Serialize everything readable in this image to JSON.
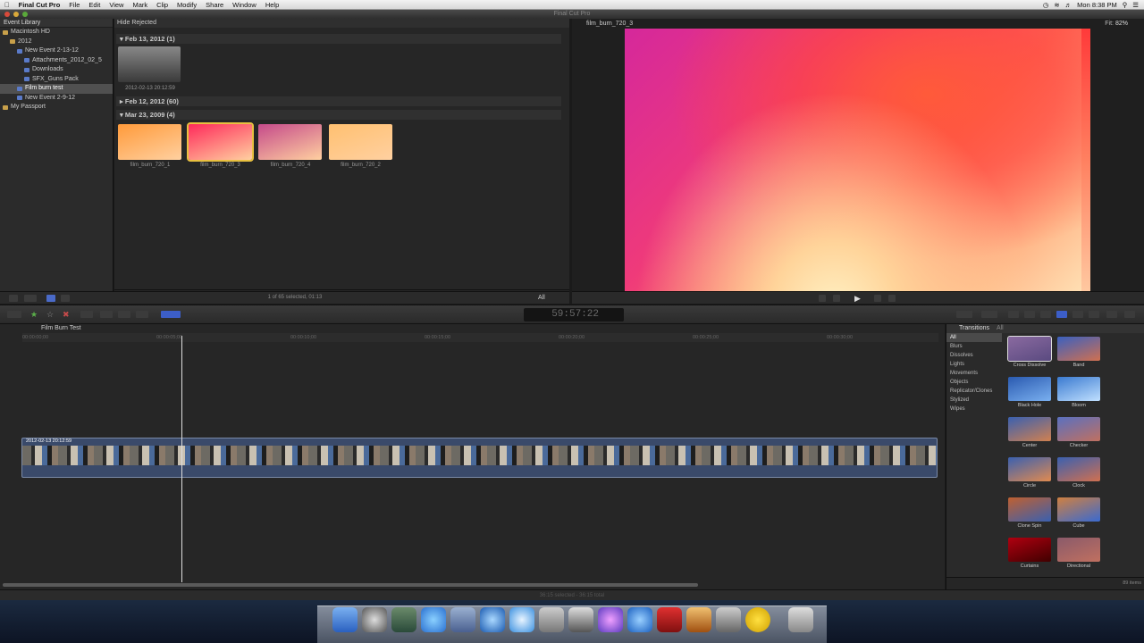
{
  "menubar": {
    "app": "Final Cut Pro",
    "items": [
      "File",
      "Edit",
      "View",
      "Mark",
      "Clip",
      "Modify",
      "Share",
      "Window",
      "Help"
    ],
    "clock": "Mon 8:38 PM"
  },
  "window": {
    "title": "Final Cut Pro"
  },
  "library": {
    "header": "Event Library",
    "items": [
      {
        "label": "Macintosh HD",
        "indent": 0
      },
      {
        "label": "2012",
        "indent": 1
      },
      {
        "label": "New Event 2-13-12",
        "indent": 2
      },
      {
        "label": "Attachments_2012_02_5",
        "indent": 3
      },
      {
        "label": "Downloads",
        "indent": 3
      },
      {
        "label": "SFX_Guns Pack",
        "indent": 3
      },
      {
        "label": "Film burn test",
        "indent": 2,
        "selected": true
      },
      {
        "label": "New Event 2-9-12",
        "indent": 2
      },
      {
        "label": "My Passport",
        "indent": 0
      }
    ]
  },
  "browser": {
    "header": "Hide Rejected",
    "groups": [
      {
        "label": "Feb 13, 2012  (1)"
      },
      {
        "label": "Feb 12, 2012  (60)"
      },
      {
        "label": "Mar 23, 2009  (4)"
      }
    ],
    "clip_first": "2012-02-13 20:12:59",
    "clips": [
      {
        "label": "film_burn_720_1",
        "color": "#ff9a3a"
      },
      {
        "label": "film_burn_720_3",
        "color": "#ff2a5a"
      },
      {
        "label": "film_burn_720_4",
        "color": "#c54a8a"
      },
      {
        "label": "film_burn_720_2",
        "color": "#ffc070"
      }
    ],
    "footer": "1 of 65 selected, 01:13",
    "filter": "All"
  },
  "viewer": {
    "title": "film_burn_720_3",
    "fit_label": "Fit:",
    "zoom": "82%"
  },
  "toolbar": {
    "timecode": "59:57:22"
  },
  "timeline": {
    "project": "Film Burn Test",
    "ruler": [
      "00:00:00;00",
      "00:00:05;00",
      "00:00:10;00",
      "00:00:15;00",
      "00:00:20;00",
      "00:00:25;00",
      "00:00:30;00"
    ],
    "clip_label": "2012-02-13 20:12:59",
    "status": "36:15 selected - 36:15 total"
  },
  "transitions": {
    "title": "Transitions",
    "filter": "All",
    "categories": [
      "All",
      "Blurs",
      "Dissolves",
      "Lights",
      "Movements",
      "Objects",
      "Replicator/Clones",
      "Stylized",
      "Wipes"
    ],
    "items": [
      "Cross Dissolve",
      "Band",
      "Black Hole",
      "Bloom",
      "Center",
      "Checker",
      "Circle",
      "Clock",
      "Clone Spin",
      "Cube",
      "Curtains",
      "Directional"
    ],
    "count": "89 items"
  }
}
